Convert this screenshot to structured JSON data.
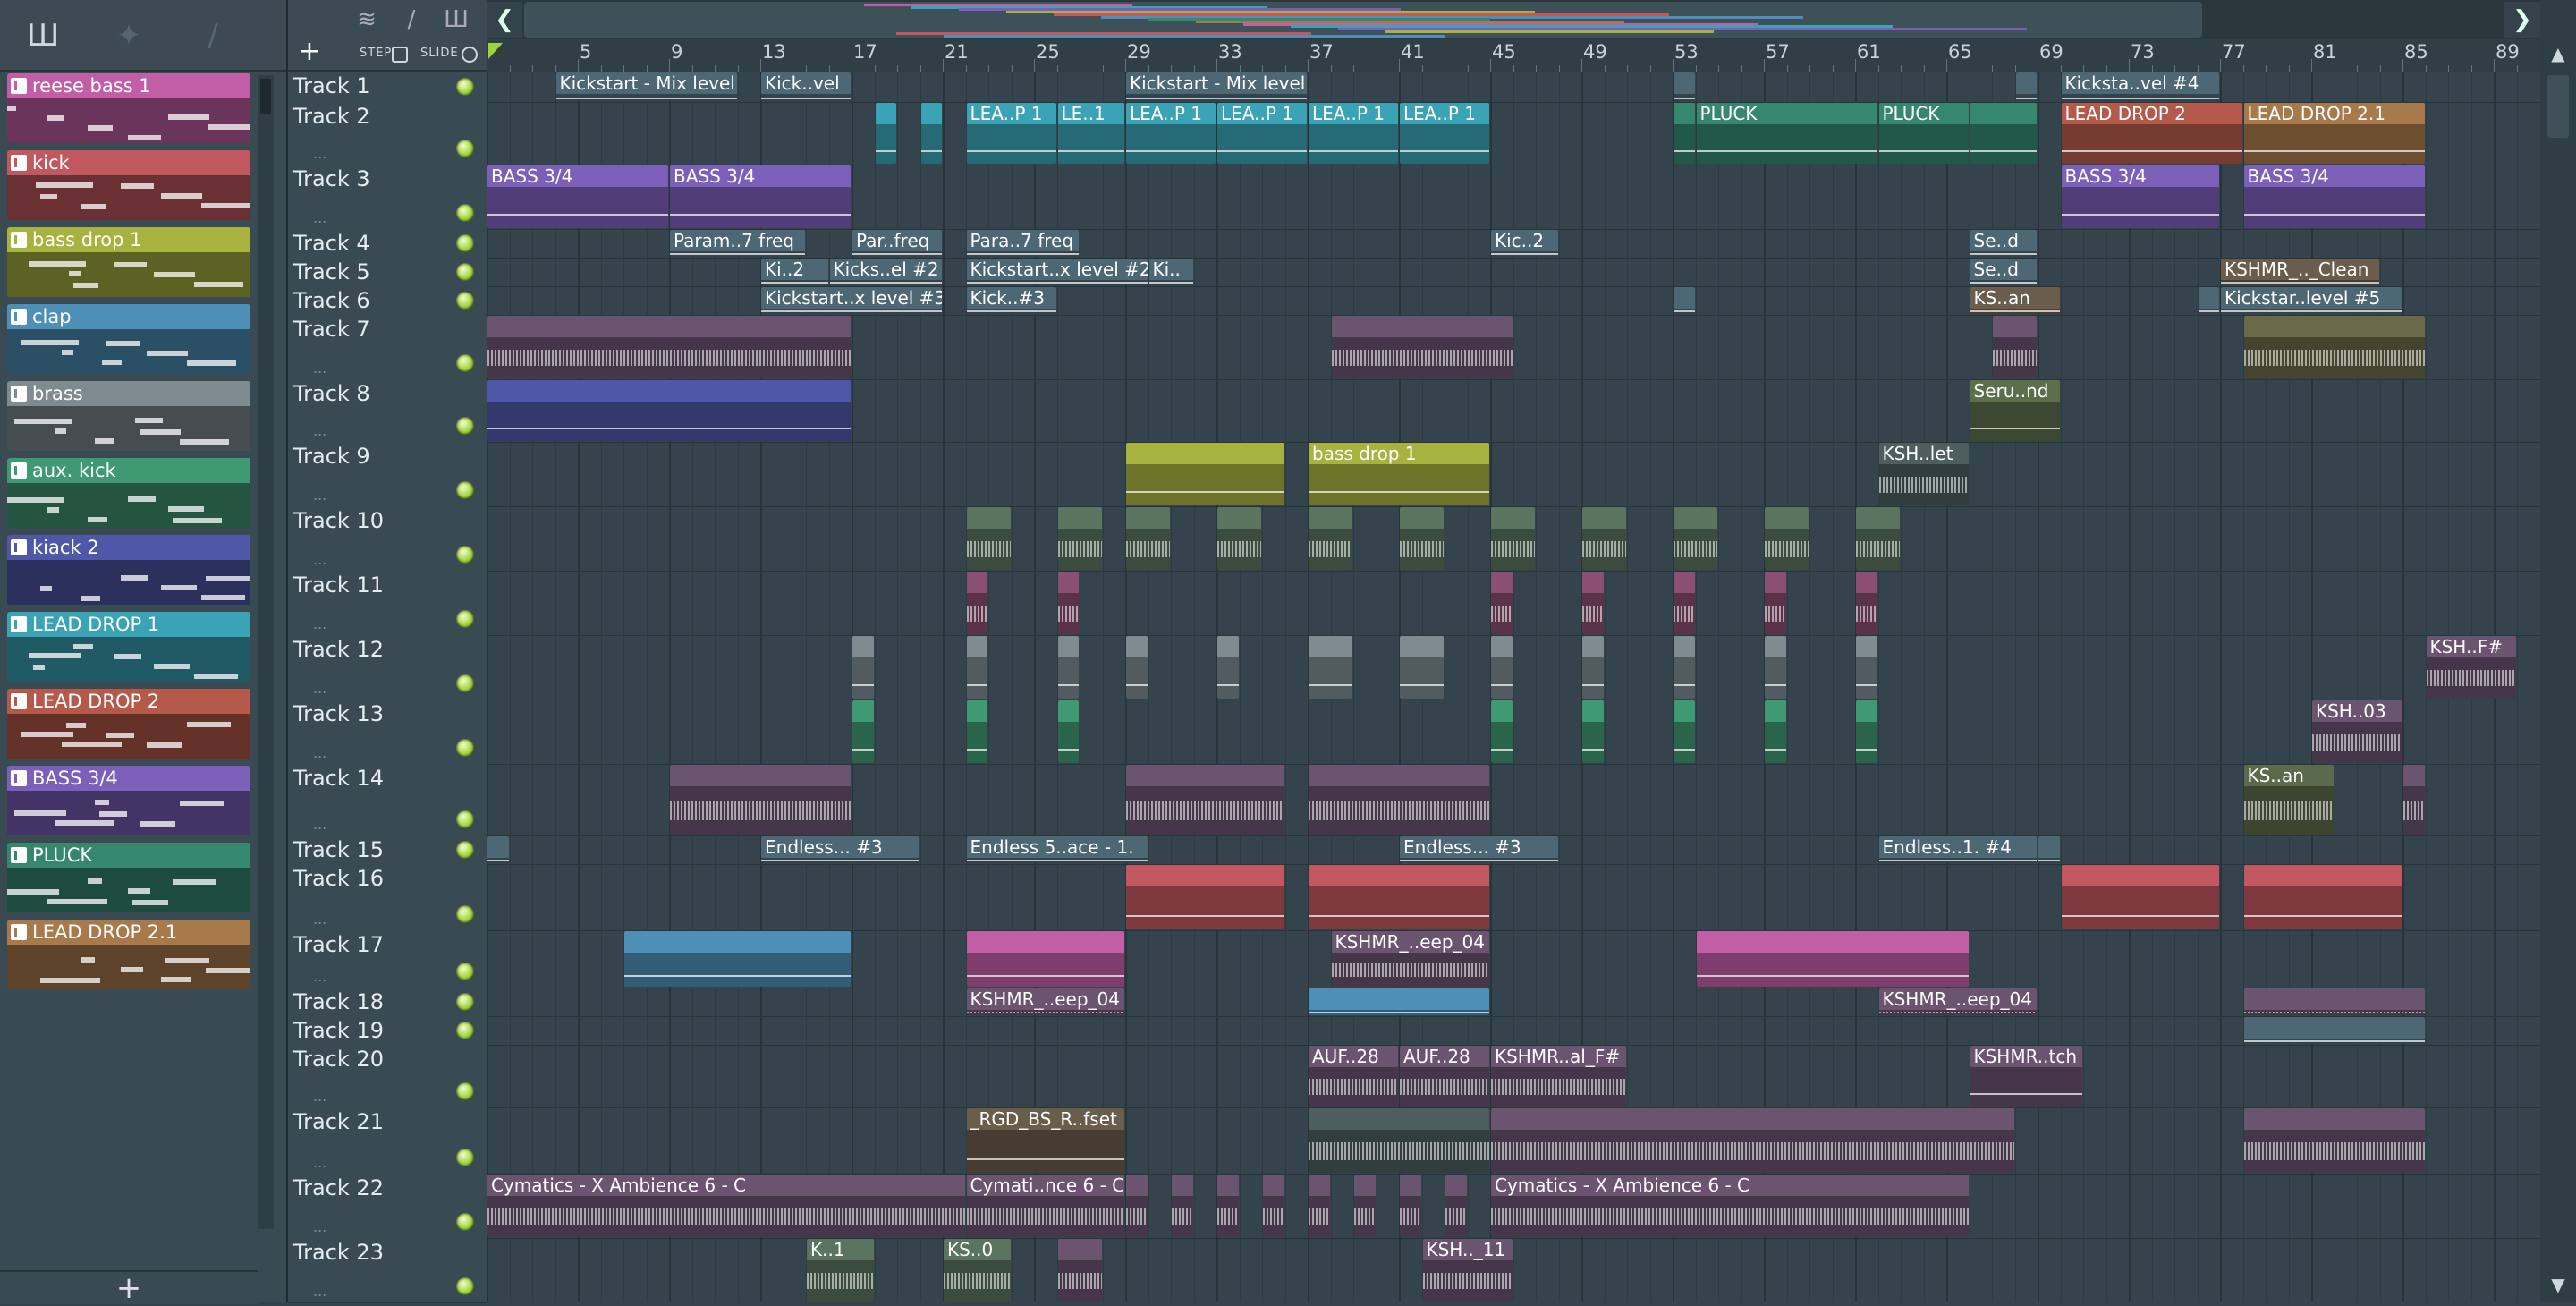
{
  "toolbar": {
    "left_icons": [
      "pattern-picker-icon",
      "audio-picker-icon",
      "automation-picker-icon"
    ],
    "track_icons": [
      "waveform-icon",
      "automation-icon",
      "pattern-icon"
    ],
    "add_track_label": "+",
    "step_label": "STEP",
    "slide_label": "SLIDE"
  },
  "patterns": [
    {
      "label": "reese bass 1",
      "color": "#c25ea6"
    },
    {
      "label": "kick",
      "color": "#c2585f"
    },
    {
      "label": "bass drop 1",
      "color": "#a7b23f"
    },
    {
      "label": "clap",
      "color": "#4e8fb7"
    },
    {
      "label": "brass",
      "color": "#7e8c92"
    },
    {
      "label": "aux. kick",
      "color": "#3f9a74"
    },
    {
      "label": "kiack 2",
      "color": "#4f58a8"
    },
    {
      "label": "LEAD DROP 1",
      "color": "#3aa3b5"
    },
    {
      "label": "LEAD DROP 2",
      "color": "#b55a4b"
    },
    {
      "label": "BASS 3/4",
      "color": "#7c5fb8"
    },
    {
      "label": "PLUCK",
      "color": "#35886e"
    },
    {
      "label": "LEAD DROP 2.1",
      "color": "#a8794a"
    }
  ],
  "add_pattern_label": "+",
  "ruler": [
    "5",
    "9",
    "13",
    "17",
    "21",
    "25",
    "29",
    "33",
    "37",
    "41",
    "45",
    "49",
    "53",
    "57",
    "61",
    "65",
    "69",
    "73",
    "77",
    "81",
    "85",
    "89"
  ],
  "tracks": [
    {
      "name": "Track 1"
    },
    {
      "name": "Track 2"
    },
    {
      "name": "Track 3"
    },
    {
      "name": "Track 4"
    },
    {
      "name": "Track 5"
    },
    {
      "name": "Track 6"
    },
    {
      "name": "Track 7"
    },
    {
      "name": "Track 8"
    },
    {
      "name": "Track 9"
    },
    {
      "name": "Track 10"
    },
    {
      "name": "Track 11"
    },
    {
      "name": "Track 12"
    },
    {
      "name": "Track 13"
    },
    {
      "name": "Track 14"
    },
    {
      "name": "Track 15"
    },
    {
      "name": "Track 16"
    },
    {
      "name": "Track 17"
    },
    {
      "name": "Track 18"
    },
    {
      "name": "Track 19"
    },
    {
      "name": "Track 20"
    },
    {
      "name": "Track 21"
    },
    {
      "name": "Track 22"
    },
    {
      "name": "Track 23"
    }
  ],
  "clips": [
    {
      "t": 0,
      "b": 4,
      "l": 8,
      "label": "Kickstart - Mix level",
      "color": "#4e6774",
      "kind": "auto"
    },
    {
      "t": 0,
      "b": 13,
      "l": 4,
      "label": "Kick..vel",
      "color": "#4e6774",
      "kind": "auto"
    },
    {
      "t": 0,
      "b": 29,
      "l": 8,
      "label": "Kickstart - Mix level",
      "color": "#4e6774",
      "kind": "auto"
    },
    {
      "t": 0,
      "b": 53,
      "l": 1,
      "label": "",
      "color": "#4e6774",
      "kind": "auto"
    },
    {
      "t": 0,
      "b": 68,
      "l": 1,
      "label": "",
      "color": "#4e6774",
      "kind": "auto"
    },
    {
      "t": 0,
      "b": 70,
      "l": 7,
      "label": "Kicksta..vel #4",
      "color": "#4e6774",
      "kind": "auto"
    },
    {
      "t": 1,
      "b": 18,
      "l": 1,
      "label": "",
      "color": "#3aa3b5",
      "kind": "pat"
    },
    {
      "t": 1,
      "b": 20,
      "l": 1,
      "label": "",
      "color": "#3aa3b5",
      "kind": "pat"
    },
    {
      "t": 1,
      "b": 22,
      "l": 4,
      "label": "LEA..P 1",
      "color": "#3aa3b5",
      "kind": "pat"
    },
    {
      "t": 1,
      "b": 26,
      "l": 3,
      "label": "LE..1",
      "color": "#3aa3b5",
      "kind": "pat"
    },
    {
      "t": 1,
      "b": 29,
      "l": 4,
      "label": "LEA..P 1",
      "color": "#3aa3b5",
      "kind": "pat"
    },
    {
      "t": 1,
      "b": 33,
      "l": 4,
      "label": "LEA..P 1",
      "color": "#3aa3b5",
      "kind": "pat"
    },
    {
      "t": 1,
      "b": 37,
      "l": 4,
      "label": "LEA..P 1",
      "color": "#3aa3b5",
      "kind": "pat"
    },
    {
      "t": 1,
      "b": 41,
      "l": 4,
      "label": "LEA..P 1",
      "color": "#3aa3b5",
      "kind": "pat"
    },
    {
      "t": 1,
      "b": 53,
      "l": 1,
      "label": "",
      "color": "#35886e",
      "kind": "pat"
    },
    {
      "t": 1,
      "b": 54,
      "l": 8,
      "label": "PLUCK",
      "color": "#35886e",
      "kind": "pat"
    },
    {
      "t": 1,
      "b": 62,
      "l": 4,
      "label": "PLUCK",
      "color": "#35886e",
      "kind": "pat"
    },
    {
      "t": 1,
      "b": 66,
      "l": 3,
      "label": "",
      "color": "#35886e",
      "kind": "pat"
    },
    {
      "t": 1,
      "b": 70,
      "l": 8,
      "label": "LEAD DROP 2",
      "color": "#b55a4b",
      "kind": "pat"
    },
    {
      "t": 1,
      "b": 78,
      "l": 8,
      "label": "LEAD DROP 2.1",
      "color": "#a8794a",
      "kind": "pat"
    },
    {
      "t": 2,
      "b": 1,
      "l": 8,
      "label": "BASS 3/4",
      "color": "#7c5fb8",
      "kind": "pat"
    },
    {
      "t": 2,
      "b": 9,
      "l": 8,
      "label": "BASS 3/4",
      "color": "#7c5fb8",
      "kind": "pat"
    },
    {
      "t": 2,
      "b": 70,
      "l": 7,
      "label": "BASS 3/4",
      "color": "#7c5fb8",
      "kind": "pat"
    },
    {
      "t": 2,
      "b": 78,
      "l": 8,
      "label": "BASS 3/4",
      "color": "#7c5fb8",
      "kind": "pat"
    },
    {
      "t": 3,
      "b": 9,
      "l": 6,
      "label": "Param..7 freq",
      "color": "#4e6774",
      "kind": "auto"
    },
    {
      "t": 3,
      "b": 17,
      "l": 4,
      "label": "Par..freq",
      "color": "#4e6774",
      "kind": "auto"
    },
    {
      "t": 3,
      "b": 22,
      "l": 5,
      "label": "Para..7 freq",
      "color": "#4e6774",
      "kind": "auto"
    },
    {
      "t": 3,
      "b": 45,
      "l": 3,
      "label": "Kic..2",
      "color": "#4e6774",
      "kind": "auto"
    },
    {
      "t": 3,
      "b": 66,
      "l": 3,
      "label": "Se..d",
      "color": "#4e6774",
      "kind": "auto"
    },
    {
      "t": 4,
      "b": 13,
      "l": 3,
      "label": "Ki..2",
      "color": "#4e6774",
      "kind": "auto"
    },
    {
      "t": 4,
      "b": 16,
      "l": 5,
      "label": "Kicks..el #2",
      "color": "#4e6774",
      "kind": "auto"
    },
    {
      "t": 4,
      "b": 22,
      "l": 8,
      "label": "Kickstart..x level #2",
      "color": "#4e6774",
      "kind": "auto"
    },
    {
      "t": 4,
      "b": 30,
      "l": 2,
      "label": "Ki..",
      "color": "#4e6774",
      "kind": "auto"
    },
    {
      "t": 4,
      "b": 66,
      "l": 3,
      "label": "Se..d",
      "color": "#4e6774",
      "kind": "auto"
    },
    {
      "t": 4,
      "b": 77,
      "l": 7,
      "label": "KSHMR_.._Clean",
      "color": "#6b5d4c",
      "kind": "auto"
    },
    {
      "t": 5,
      "b": 13,
      "l": 8,
      "label": "Kickstart..x level #3",
      "color": "#4e6774",
      "kind": "auto"
    },
    {
      "t": 5,
      "b": 22,
      "l": 4,
      "label": "Kick..#3",
      "color": "#4e6774",
      "kind": "auto"
    },
    {
      "t": 5,
      "b": 53,
      "l": 1,
      "label": "",
      "color": "#4e6774",
      "kind": "auto"
    },
    {
      "t": 5,
      "b": 66,
      "l": 4,
      "label": "KS..an",
      "color": "#6b5d4c",
      "kind": "auto"
    },
    {
      "t": 5,
      "b": 76,
      "l": 1,
      "label": "",
      "color": "#4e6774",
      "kind": "auto"
    },
    {
      "t": 5,
      "b": 77,
      "l": 8,
      "label": "Kickstar..level #5",
      "color": "#4e6774",
      "kind": "auto"
    },
    {
      "t": 6,
      "b": 1,
      "l": 16,
      "label": "",
      "color": "#6a5470",
      "kind": "wave"
    },
    {
      "t": 6,
      "b": 38,
      "l": 8,
      "label": "",
      "color": "#6a5470",
      "kind": "wave"
    },
    {
      "t": 6,
      "b": 67,
      "l": 2,
      "label": "",
      "color": "#6a5470",
      "kind": "wave"
    },
    {
      "t": 6,
      "b": 78,
      "l": 8,
      "label": "",
      "color": "#6a6a48",
      "kind": "wave"
    },
    {
      "t": 7,
      "b": 1,
      "l": 16,
      "label": "",
      "color": "#4f58a8",
      "kind": "pat"
    },
    {
      "t": 7,
      "b": 66,
      "l": 4,
      "label": "Seru..nd",
      "color": "#5c6f4c",
      "kind": "auto"
    },
    {
      "t": 8,
      "b": 29,
      "l": 7,
      "label": "",
      "color": "#a7b23f",
      "kind": "pat"
    },
    {
      "t": 8,
      "b": 37,
      "l": 8,
      "label": "bass drop 1",
      "color": "#a7b23f",
      "kind": "pat"
    },
    {
      "t": 8,
      "b": 62,
      "l": 4,
      "label": "KSH..let",
      "color": "#4c5f5e",
      "kind": "wave"
    },
    {
      "t": 9,
      "b": 22,
      "l": 2,
      "label": "",
      "color": "#5a7460",
      "kind": "wave"
    },
    {
      "t": 9,
      "b": 26,
      "l": 2,
      "label": "",
      "color": "#5a7460",
      "kind": "wave"
    },
    {
      "t": 9,
      "b": 29,
      "l": 2,
      "label": "",
      "color": "#5a7460",
      "kind": "wave"
    },
    {
      "t": 9,
      "b": 33,
      "l": 2,
      "label": "",
      "color": "#5a7460",
      "kind": "wave"
    },
    {
      "t": 9,
      "b": 37,
      "l": 2,
      "label": "",
      "color": "#5a7460",
      "kind": "wave"
    },
    {
      "t": 9,
      "b": 41,
      "l": 2,
      "label": "",
      "color": "#5a7460",
      "kind": "wave"
    },
    {
      "t": 9,
      "b": 45,
      "l": 2,
      "label": "",
      "color": "#5a7460",
      "kind": "wave"
    },
    {
      "t": 9,
      "b": 49,
      "l": 2,
      "label": "",
      "color": "#5a7460",
      "kind": "wave"
    },
    {
      "t": 9,
      "b": 53,
      "l": 2,
      "label": "",
      "color": "#5a7460",
      "kind": "wave"
    },
    {
      "t": 9,
      "b": 57,
      "l": 2,
      "label": "",
      "color": "#5a7460",
      "kind": "wave"
    },
    {
      "t": 9,
      "b": 61,
      "l": 2,
      "label": "",
      "color": "#5a7460",
      "kind": "wave"
    },
    {
      "t": 10,
      "b": 22,
      "l": 1,
      "label": "",
      "color": "#8a4f72",
      "kind": "wave"
    },
    {
      "t": 10,
      "b": 26,
      "l": 1,
      "label": "",
      "color": "#8a4f72",
      "kind": "wave"
    },
    {
      "t": 10,
      "b": 45,
      "l": 1,
      "label": "",
      "color": "#8a4f72",
      "kind": "wave"
    },
    {
      "t": 10,
      "b": 49,
      "l": 1,
      "label": "",
      "color": "#8a4f72",
      "kind": "wave"
    },
    {
      "t": 10,
      "b": 53,
      "l": 1,
      "label": "",
      "color": "#8a4f72",
      "kind": "wave"
    },
    {
      "t": 10,
      "b": 57,
      "l": 1,
      "label": "",
      "color": "#8a4f72",
      "kind": "wave"
    },
    {
      "t": 10,
      "b": 61,
      "l": 1,
      "label": "",
      "color": "#8a4f72",
      "kind": "wave"
    },
    {
      "t": 11,
      "b": 17,
      "l": 1,
      "label": "",
      "color": "#7e8c92",
      "kind": "pat"
    },
    {
      "t": 11,
      "b": 22,
      "l": 1,
      "label": "",
      "color": "#7e8c92",
      "kind": "pat"
    },
    {
      "t": 11,
      "b": 26,
      "l": 1,
      "label": "",
      "color": "#7e8c92",
      "kind": "pat"
    },
    {
      "t": 11,
      "b": 29,
      "l": 1,
      "label": "",
      "color": "#7e8c92",
      "kind": "pat"
    },
    {
      "t": 11,
      "b": 33,
      "l": 1,
      "label": "",
      "color": "#7e8c92",
      "kind": "pat"
    },
    {
      "t": 11,
      "b": 37,
      "l": 2,
      "label": "",
      "color": "#7e8c92",
      "kind": "pat"
    },
    {
      "t": 11,
      "b": 41,
      "l": 2,
      "label": "",
      "color": "#7e8c92",
      "kind": "pat"
    },
    {
      "t": 11,
      "b": 45,
      "l": 1,
      "label": "",
      "color": "#7e8c92",
      "kind": "pat"
    },
    {
      "t": 11,
      "b": 49,
      "l": 1,
      "label": "",
      "color": "#7e8c92",
      "kind": "pat"
    },
    {
      "t": 11,
      "b": 53,
      "l": 1,
      "label": "",
      "color": "#7e8c92",
      "kind": "pat"
    },
    {
      "t": 11,
      "b": 57,
      "l": 1,
      "label": "",
      "color": "#7e8c92",
      "kind": "pat"
    },
    {
      "t": 11,
      "b": 61,
      "l": 1,
      "label": "",
      "color": "#7e8c92",
      "kind": "pat"
    },
    {
      "t": 11,
      "b": 86,
      "l": 4,
      "label": "KSH..F#",
      "color": "#6a5470",
      "kind": "wave"
    },
    {
      "t": 12,
      "b": 17,
      "l": 1,
      "label": "",
      "color": "#3f9a74",
      "kind": "pat"
    },
    {
      "t": 12,
      "b": 22,
      "l": 1,
      "label": "",
      "color": "#3f9a74",
      "kind": "pat"
    },
    {
      "t": 12,
      "b": 26,
      "l": 1,
      "label": "",
      "color": "#3f9a74",
      "kind": "pat"
    },
    {
      "t": 12,
      "b": 45,
      "l": 1,
      "label": "",
      "color": "#3f9a74",
      "kind": "pat"
    },
    {
      "t": 12,
      "b": 49,
      "l": 1,
      "label": "",
      "color": "#3f9a74",
      "kind": "pat"
    },
    {
      "t": 12,
      "b": 53,
      "l": 1,
      "label": "",
      "color": "#3f9a74",
      "kind": "pat"
    },
    {
      "t": 12,
      "b": 57,
      "l": 1,
      "label": "",
      "color": "#3f9a74",
      "kind": "pat"
    },
    {
      "t": 12,
      "b": 61,
      "l": 1,
      "label": "",
      "color": "#3f9a74",
      "kind": "pat"
    },
    {
      "t": 12,
      "b": 81,
      "l": 4,
      "label": "KSH..03",
      "color": "#6a5470",
      "kind": "wave"
    },
    {
      "t": 13,
      "b": 9,
      "l": 8,
      "label": "",
      "color": "#6a5470",
      "kind": "wave"
    },
    {
      "t": 13,
      "b": 29,
      "l": 7,
      "label": "",
      "color": "#6a5470",
      "kind": "wave"
    },
    {
      "t": 13,
      "b": 37,
      "l": 8,
      "label": "",
      "color": "#6a5470",
      "kind": "wave"
    },
    {
      "t": 13,
      "b": 78,
      "l": 4,
      "label": "KS..an",
      "color": "#5b6a4a",
      "kind": "wave"
    },
    {
      "t": 13,
      "b": 85,
      "l": 1,
      "label": "",
      "color": "#6a5470",
      "kind": "wave"
    },
    {
      "t": 14,
      "b": 1,
      "l": 1,
      "label": "",
      "color": "#4e6774",
      "kind": "auto"
    },
    {
      "t": 14,
      "b": 13,
      "l": 7,
      "label": "Endless...     #3",
      "color": "#4e6774",
      "kind": "auto"
    },
    {
      "t": 14,
      "b": 22,
      "l": 8,
      "label": "Endless 5..ace - 1.",
      "color": "#4e6774",
      "kind": "auto"
    },
    {
      "t": 14,
      "b": 41,
      "l": 7,
      "label": "Endless...      #3",
      "color": "#4e6774",
      "kind": "auto"
    },
    {
      "t": 14,
      "b": 62,
      "l": 7,
      "label": "Endless..1.     #4",
      "color": "#4e6774",
      "kind": "auto"
    },
    {
      "t": 14,
      "b": 69,
      "l": 1,
      "label": "",
      "color": "#4e6774",
      "kind": "auto"
    },
    {
      "t": 15,
      "b": 29,
      "l": 7,
      "label": "",
      "color": "#c2585f",
      "kind": "pat"
    },
    {
      "t": 15,
      "b": 37,
      "l": 8,
      "label": "",
      "color": "#c2585f",
      "kind": "pat"
    },
    {
      "t": 15,
      "b": 70,
      "l": 7,
      "label": "",
      "color": "#c2585f",
      "kind": "pat"
    },
    {
      "t": 15,
      "b": 78,
      "l": 7,
      "label": "",
      "color": "#c2585f",
      "kind": "pat"
    },
    {
      "t": 16,
      "b": 7,
      "l": 10,
      "label": "",
      "color": "#4e8fb7",
      "kind": "pat"
    },
    {
      "t": 16,
      "b": 22,
      "l": 7,
      "label": "",
      "color": "#c25ea6",
      "kind": "pat"
    },
    {
      "t": 16,
      "b": 38,
      "l": 7,
      "label": "KSHMR_..eep_04",
      "color": "#6a5470",
      "kind": "wave"
    },
    {
      "t": 16,
      "b": 54,
      "l": 12,
      "label": "",
      "color": "#c25ea6",
      "kind": "pat"
    },
    {
      "t": 17,
      "b": 22,
      "l": 7,
      "label": "KSHMR_..eep_04",
      "color": "#6a5470",
      "kind": "wave"
    },
    {
      "t": 17,
      "b": 37,
      "l": 8,
      "label": "",
      "color": "#4e8fb7",
      "kind": "pat"
    },
    {
      "t": 17,
      "b": 62,
      "l": 7,
      "label": "KSHMR_..eep_04",
      "color": "#6a5470",
      "kind": "wave"
    },
    {
      "t": 17,
      "b": 78,
      "l": 8,
      "label": "",
      "color": "#6a5470",
      "kind": "wave"
    },
    {
      "t": 18,
      "b": 78,
      "l": 8,
      "label": "",
      "color": "#4e6774",
      "kind": "pat"
    },
    {
      "t": 19,
      "b": 37,
      "l": 4,
      "label": "AUF..28",
      "color": "#6a5470",
      "kind": "wave"
    },
    {
      "t": 19,
      "b": 41,
      "l": 4,
      "label": "AUF..28",
      "color": "#6a5470",
      "kind": "wave"
    },
    {
      "t": 19,
      "b": 45,
      "l": 6,
      "label": "KSHMR..al_F#",
      "color": "#6a5470",
      "kind": "wave"
    },
    {
      "t": 19,
      "b": 66,
      "l": 5,
      "label": "KSHMR..tch",
      "color": "#6a5470",
      "kind": "auto"
    },
    {
      "t": 20,
      "b": 22,
      "l": 7,
      "label": "_RGD_BS_R..fset",
      "color": "#6b5d4c",
      "kind": "auto"
    },
    {
      "t": 20,
      "b": 37,
      "l": 8,
      "label": "",
      "color": "#4c5f5e",
      "kind": "wave"
    },
    {
      "t": 20,
      "b": 45,
      "l": 23,
      "label": "",
      "color": "#6a5470",
      "kind": "wave"
    },
    {
      "t": 20,
      "b": 78,
      "l": 8,
      "label": "",
      "color": "#6a5470",
      "kind": "wave"
    },
    {
      "t": 21,
      "b": 1,
      "l": 21,
      "label": "Cymatics - X Ambience 6 - C",
      "color": "#6a5470",
      "kind": "wave"
    },
    {
      "t": 21,
      "b": 22,
      "l": 7,
      "label": "Cymati..nce 6 - C",
      "color": "#6a5470",
      "kind": "wave"
    },
    {
      "t": 21,
      "b": 29,
      "l": 1,
      "label": "",
      "color": "#6a5470",
      "kind": "wave"
    },
    {
      "t": 21,
      "b": 31,
      "l": 1,
      "label": "",
      "color": "#6a5470",
      "kind": "wave"
    },
    {
      "t": 21,
      "b": 33,
      "l": 1,
      "label": "",
      "color": "#6a5470",
      "kind": "wave"
    },
    {
      "t": 21,
      "b": 35,
      "l": 1,
      "label": "",
      "color": "#6a5470",
      "kind": "wave"
    },
    {
      "t": 21,
      "b": 37,
      "l": 1,
      "label": "",
      "color": "#6a5470",
      "kind": "wave"
    },
    {
      "t": 21,
      "b": 39,
      "l": 1,
      "label": "",
      "color": "#6a5470",
      "kind": "wave"
    },
    {
      "t": 21,
      "b": 41,
      "l": 1,
      "label": "",
      "color": "#6a5470",
      "kind": "wave"
    },
    {
      "t": 21,
      "b": 43,
      "l": 1,
      "label": "",
      "color": "#6a5470",
      "kind": "wave"
    },
    {
      "t": 21,
      "b": 45,
      "l": 21,
      "label": "Cymatics - X Ambience 6 - C",
      "color": "#6a5470",
      "kind": "wave"
    },
    {
      "t": 22,
      "b": 15,
      "l": 3,
      "label": "K..1",
      "color": "#5a7460",
      "kind": "wave"
    },
    {
      "t": 22,
      "b": 21,
      "l": 3,
      "label": "KS..0",
      "color": "#5a7460",
      "kind": "wave"
    },
    {
      "t": 22,
      "b": 26,
      "l": 2,
      "label": "",
      "color": "#6a5470",
      "kind": "wave"
    },
    {
      "t": 22,
      "b": 42,
      "l": 4,
      "label": "KSH.._11",
      "color": "#6a5470",
      "kind": "wave"
    }
  ]
}
